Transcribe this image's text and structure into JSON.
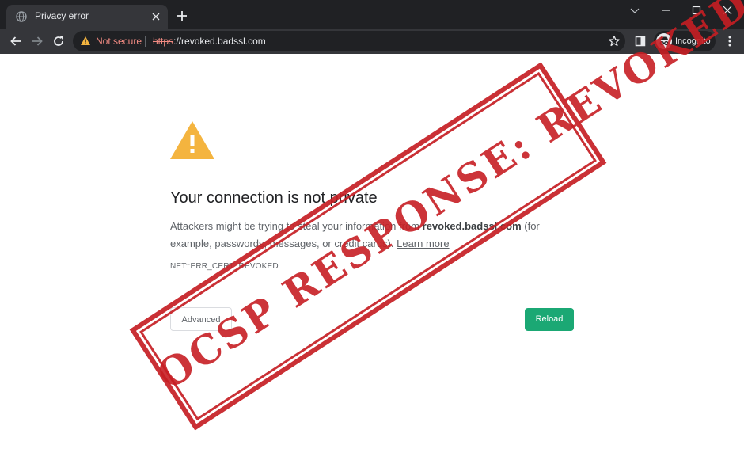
{
  "browser": {
    "tab": {
      "title": "Privacy error"
    },
    "address_bar": {
      "security_label": "Not secure",
      "url_scheme": "https",
      "url_rest": "://revoked.badssl.com"
    },
    "profile": {
      "label": "Incognito"
    }
  },
  "page": {
    "heading": "Your connection is not private",
    "paragraph_prefix": "Attackers might be trying to steal your information from ",
    "paragraph_domain": "revoked.badssl.com",
    "paragraph_middle": " (for example, passwords, messages, or credit cards). ",
    "learn_more": "Learn more",
    "error_code": "NET::ERR_CERT_REVOKED",
    "advanced_label": "Advanced",
    "reload_label": "Reload"
  },
  "overlay": {
    "stamp_text": "OCSP RESPONSE: REVOKED"
  },
  "colors": {
    "warning": "#f4b43f",
    "not_secure": "#f28b82",
    "reload_button": "#1ba874",
    "stamp": "#c61e24"
  }
}
